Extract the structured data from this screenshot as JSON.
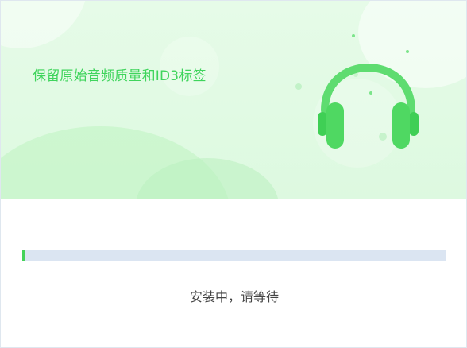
{
  "banner": {
    "slogan": "保留原始音频质量和ID3标签",
    "illustration_icon": "headphones-icon",
    "accent_color": "#45d35a"
  },
  "install": {
    "progress_fraction": 0.006,
    "status_text": "安装中，请等待"
  }
}
